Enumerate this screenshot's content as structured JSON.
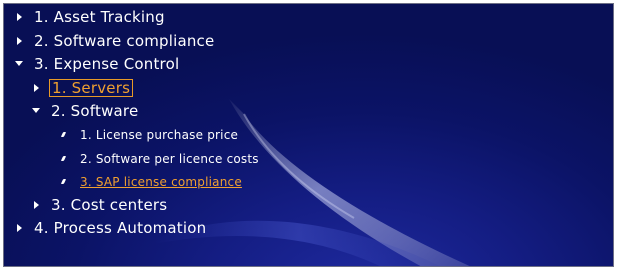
{
  "tree": {
    "items": [
      {
        "label": "1. Asset Tracking",
        "state": "collapsed"
      },
      {
        "label": "2. Software compliance",
        "state": "collapsed"
      },
      {
        "label": "3. Expense Control",
        "state": "expanded",
        "children": [
          {
            "label": "1. Servers",
            "state": "collapsed",
            "selected": true
          },
          {
            "label": "2. Software",
            "state": "expanded",
            "children": [
              {
                "label": "1. License purchase price"
              },
              {
                "label": "2. Software per licence costs"
              },
              {
                "label": "3. SAP license compliance",
                "active": true
              }
            ]
          },
          {
            "label": "3. Cost centers",
            "state": "collapsed"
          }
        ]
      },
      {
        "label": "4. Process Automation",
        "state": "collapsed"
      }
    ]
  },
  "colors": {
    "background": "#0b1366",
    "text": "#ffffff",
    "highlight": "#f0a030"
  }
}
